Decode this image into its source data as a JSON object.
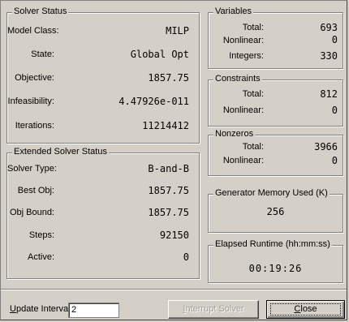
{
  "solver_status": {
    "title": "Solver Status",
    "rows": [
      {
        "label": "Model Class:",
        "value": "MILP"
      },
      {
        "label": "State:",
        "value": "Global Opt"
      },
      {
        "label": "Objective:",
        "value": "1857.75"
      },
      {
        "label": "Infeasibility:",
        "value": "4.47926e-011"
      },
      {
        "label": "Iterations:",
        "value": "11214412"
      }
    ]
  },
  "extended_solver_status": {
    "title": "Extended Solver Status",
    "rows": [
      {
        "label": "Solver Type:",
        "value": "B-and-B"
      },
      {
        "label": "Best Obj:",
        "value": "1857.75"
      },
      {
        "label": "Obj Bound:",
        "value": "1857.75"
      },
      {
        "label": "Steps:",
        "value": "92150"
      },
      {
        "label": "Active:",
        "value": "0"
      }
    ]
  },
  "variables": {
    "title": "Variables",
    "rows": [
      {
        "label": "Total:",
        "value": "693"
      },
      {
        "label": "Nonlinear:",
        "value": "0"
      },
      {
        "label": "Integers:",
        "value": "330"
      }
    ]
  },
  "constraints": {
    "title": "Constraints",
    "rows": [
      {
        "label": "Total:",
        "value": "812"
      },
      {
        "label": "Nonlinear:",
        "value": "0"
      }
    ]
  },
  "nonzeros": {
    "title": "Nonzeros",
    "rows": [
      {
        "label": "Total:",
        "value": "3966"
      },
      {
        "label": "Nonlinear:",
        "value": "0"
      }
    ]
  },
  "generator_memory": {
    "title": "Generator Memory Used (K)",
    "value": "256"
  },
  "elapsed_runtime": {
    "title": "Elapsed Runtime (hh:mm:ss)",
    "value": "00:19:26"
  },
  "footer": {
    "update_interval_label_u": "U",
    "update_interval_label_rest": "pdate Interval:",
    "update_interval_value": "2",
    "interrupt_label_u": "I",
    "interrupt_label_rest": "nterrupt Solver",
    "close_label_u": "C",
    "close_label_rest": "lose"
  }
}
